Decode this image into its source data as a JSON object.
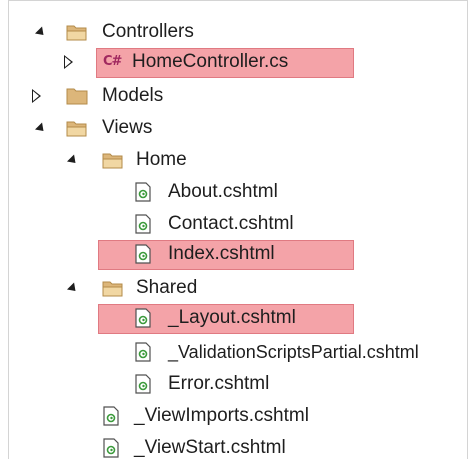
{
  "tree": {
    "items": [
      {
        "label": "Controllers",
        "icon": "folder-open-icon",
        "expander": "expanded"
      },
      {
        "label": "HomeController.cs",
        "icon": "csharp-file-icon",
        "icon_text": "C#",
        "expander": "collapsed",
        "highlighted": true
      },
      {
        "label": "Models",
        "icon": "folder-closed-icon",
        "expander": "collapsed"
      },
      {
        "label": "Views",
        "icon": "folder-open-icon",
        "expander": "expanded"
      },
      {
        "label": "Home",
        "icon": "folder-open-icon",
        "expander": "expanded"
      },
      {
        "label": "About.cshtml",
        "icon": "razor-file-icon"
      },
      {
        "label": "Contact.cshtml",
        "icon": "razor-file-icon"
      },
      {
        "label": "Index.cshtml",
        "icon": "razor-file-icon",
        "highlighted": true
      },
      {
        "label": "Shared",
        "icon": "folder-open-icon",
        "expander": "expanded"
      },
      {
        "label": "_Layout.cshtml",
        "icon": "razor-file-icon",
        "highlighted": true
      },
      {
        "label": "_ValidationScriptsPartial.cshtml",
        "icon": "razor-file-icon"
      },
      {
        "label": "Error.cshtml",
        "icon": "razor-file-icon"
      },
      {
        "label": "_ViewImports.cshtml",
        "icon": "razor-file-icon"
      },
      {
        "label": "_ViewStart.cshtml",
        "icon": "razor-file-icon"
      }
    ]
  },
  "colors": {
    "highlight_fill": "#f4a3a8",
    "highlight_border": "#e07a82",
    "folder": "#dcb67a",
    "razor_green": "#3c9a3c",
    "csharp": "#a0285f"
  }
}
